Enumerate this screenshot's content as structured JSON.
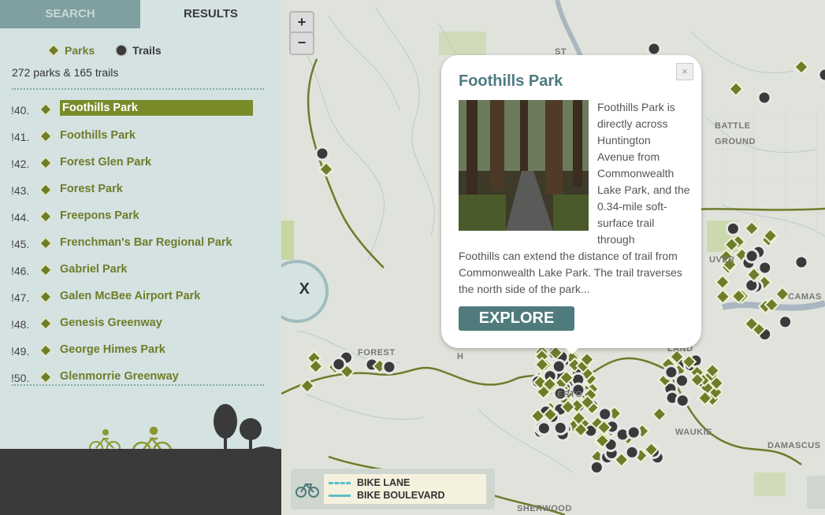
{
  "tabs": {
    "search": "SEARCH",
    "results": "RESULTS"
  },
  "legend": {
    "parks": "Parks",
    "trails": "Trails"
  },
  "results_count": "272 parks & 165 trails",
  "results": [
    {
      "num": "!40.",
      "name": "Foothills Park",
      "selected": true
    },
    {
      "num": "!41.",
      "name": "Foothills Park",
      "selected": false
    },
    {
      "num": "!42.",
      "name": "Forest Glen Park",
      "selected": false
    },
    {
      "num": "!43.",
      "name": "Forest Park",
      "selected": false
    },
    {
      "num": "!44.",
      "name": "Freepons Park",
      "selected": false
    },
    {
      "num": "!45.",
      "name": "Frenchman's Bar Regional Park",
      "selected": false
    },
    {
      "num": "!46.",
      "name": "Gabriel Park",
      "selected": false
    },
    {
      "num": "!47.",
      "name": "Galen McBee Airport Park",
      "selected": false
    },
    {
      "num": "!48.",
      "name": "Genesis Greenway",
      "selected": false
    },
    {
      "num": "!49.",
      "name": "George Himes Park",
      "selected": false
    },
    {
      "num": "!50.",
      "name": "Glenmorrie Greenway",
      "selected": false
    }
  ],
  "map": {
    "zoom_in": "+",
    "zoom_out": "−",
    "collapse": "X",
    "labels": {
      "st": "ST",
      "battle_ground": "BATTLE\nGROUND",
      "forest": "FOREST",
      "land": "LAND",
      "uver": "UVER",
      "camas": "CAMAS",
      "waukie": "WAUKIE",
      "damascus": "DAMASCUS",
      "sherwood": "SHERWOOD",
      "erto": "ERTO",
      "h": "H"
    }
  },
  "popup": {
    "title": "Foothills Park",
    "close": "×",
    "desc_right": "Foothills Park is directly across Huntington Avenue from Commonwealth Lake Park, and the 0.34-mile soft-surface trail through",
    "desc_bottom": "Foothills can extend the distance of trail from Commonwealth Lake Park. The trail traverses the north side of the park...",
    "explore": "EXPLORE"
  },
  "bike_legend": {
    "bike_lane": "BIKE LANE",
    "bike_boulevard": "BIKE BOULEVARD"
  },
  "colors": {
    "park_green": "#6e7d2a",
    "selected_bg": "#7a8b2a",
    "trail_dark": "#3a3a3a",
    "accent_teal": "#4f7b7d",
    "bike_lane": "#5bbfc6"
  }
}
